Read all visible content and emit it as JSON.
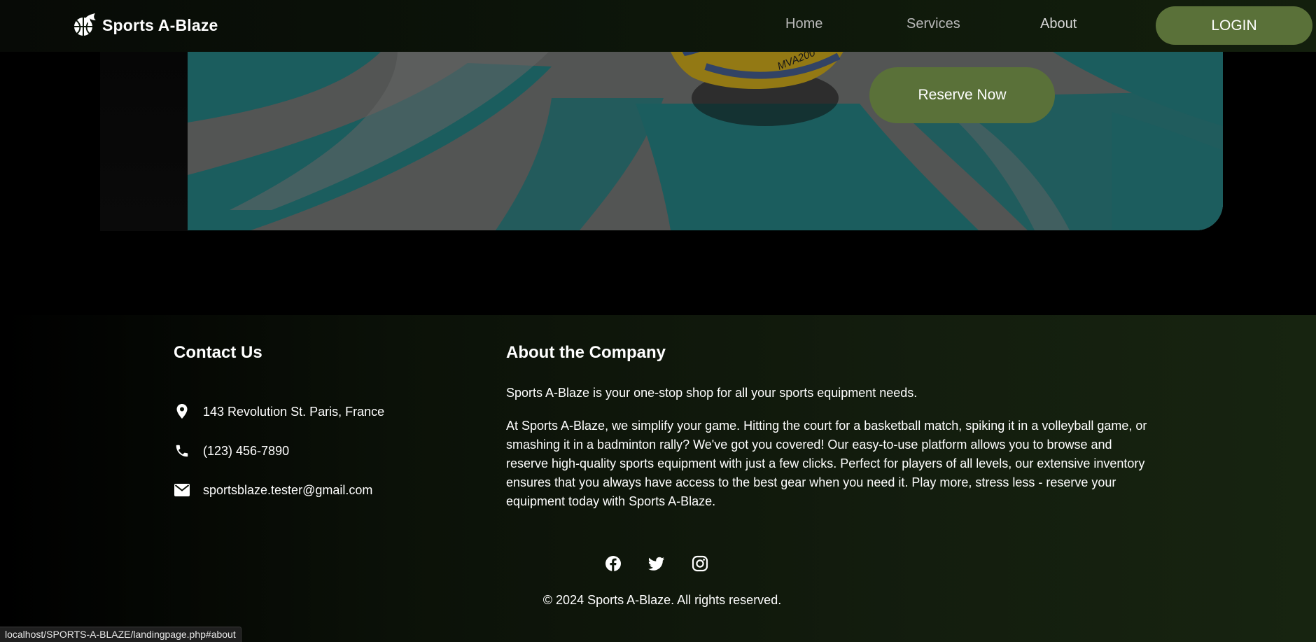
{
  "brand": {
    "name": "Sports A-Blaze",
    "logo_icon": "basketball-flame-logo"
  },
  "nav": {
    "links": [
      "Home",
      "Services",
      "About"
    ],
    "login_label": "LOGIN"
  },
  "hero": {
    "reserve_label": "Reserve Now",
    "ball_brand_text": "MVA200"
  },
  "footer": {
    "contact_heading": "Contact Us",
    "address": "143 Revolution St. Paris, France",
    "phone": "(123) 456-7890",
    "email": "sportsblaze.tester@gmail.com",
    "about_heading": "About the Company",
    "about_p1": "Sports A-Blaze is your one-stop shop for all your sports equipment needs.",
    "about_p2": "At Sports A-Blaze, we simplify your game. Hitting the court for a basketball match, spiking it in a volleyball game, or smashing it in a badminton rally? We've got you covered! Our easy-to-use platform allows you to browse and reserve high-quality sports equipment with just a few clicks. Perfect for players of all levels, our extensive inventory ensures that you always have access to the best gear when you need it. Play more, stress less - reserve your equipment today with Sports A-Blaze.",
    "socials": [
      "facebook-icon",
      "twitter-icon",
      "instagram-icon"
    ],
    "copyright": "© 2024 Sports A-Blaze. All rights reserved."
  },
  "status_bar": {
    "url": "localhost/SPORTS-A-BLAZE/landingpage.php#about"
  },
  "colors": {
    "accent": "#5a7139",
    "footer_bg": "#131d0e",
    "navbar_bg": "#0d160a",
    "court_teal": "#1f6a6b"
  }
}
